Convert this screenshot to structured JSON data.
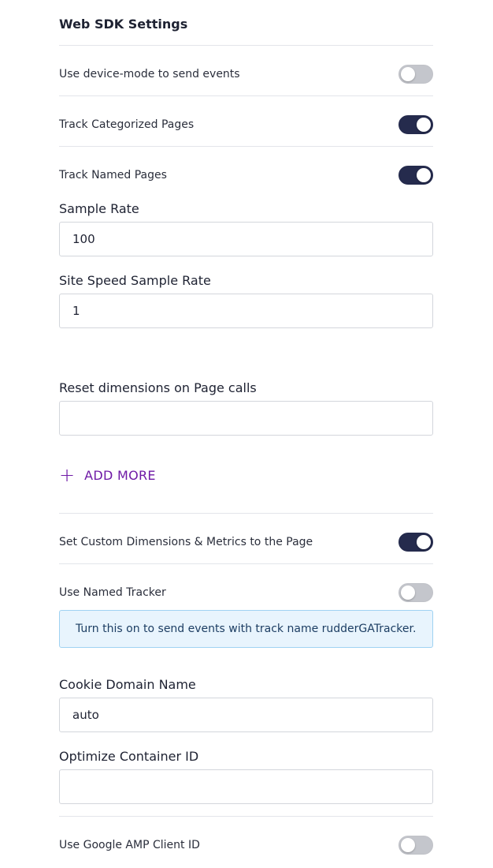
{
  "section": {
    "title": "Web SDK Settings"
  },
  "toggles": {
    "device_mode": {
      "label": "Use device-mode to send events",
      "on": false
    },
    "categorized_pages": {
      "label": "Track Categorized Pages",
      "on": true
    },
    "named_pages": {
      "label": "Track Named Pages",
      "on": true
    },
    "custom_dimensions": {
      "label": "Set Custom Dimensions & Metrics to the Page",
      "on": true
    },
    "named_tracker": {
      "label": "Use Named Tracker",
      "on": false
    },
    "amp_client_id": {
      "label": "Use Google AMP Client ID",
      "on": false
    }
  },
  "fields": {
    "sample_rate": {
      "label": "Sample Rate",
      "value": "100"
    },
    "site_speed": {
      "label": "Site Speed Sample Rate",
      "value": "1"
    },
    "reset_dimensions": {
      "label": "Reset dimensions on Page calls",
      "value": ""
    },
    "cookie_domain": {
      "label": "Cookie Domain Name",
      "value": "auto"
    },
    "optimize_container": {
      "label": "Optimize Container ID",
      "value": ""
    }
  },
  "add_more": {
    "label": "ADD MORE",
    "icon": "plus-icon",
    "color": "#6f1aa6"
  },
  "info": {
    "text": "Turn this on to send events with track name rudderGATracker."
  },
  "colors": {
    "toggle_on": "#252b4d",
    "toggle_off": "#c4c6cc",
    "info_bg": "#e8f4fd"
  }
}
